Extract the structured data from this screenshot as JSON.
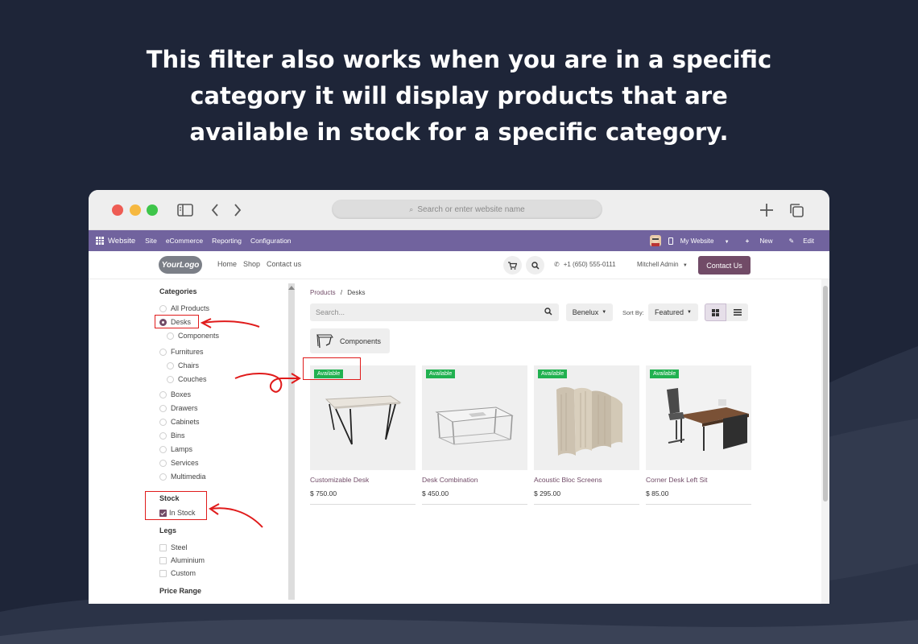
{
  "headline": {
    "line1": "This filter also works when you are in a specific",
    "line2": "category it will display products that are",
    "line3": "available in stock for a specific category."
  },
  "browser": {
    "url_placeholder": "Search or enter website name",
    "colors": {
      "close": "#ee5c54",
      "minimize": "#f6b840",
      "zoom": "#3ec54a"
    }
  },
  "odoo_nav": {
    "brand": "Website",
    "items": [
      "Site",
      "eCommerce",
      "Reporting",
      "Configuration"
    ],
    "my_website": "My Website",
    "new": "New",
    "edit": "Edit"
  },
  "site_header": {
    "logo": "YourLogo",
    "menu": [
      "Home",
      "Shop",
      "Contact us"
    ],
    "phone": "+1 (650) 555-0111",
    "user": "Mitchell Admin",
    "contact_button": "Contact Us"
  },
  "sidebar": {
    "categories_title": "Categories",
    "categories": [
      {
        "label": "All Products",
        "selected": false
      },
      {
        "label": "Desks",
        "selected": true
      },
      {
        "label": "Components",
        "selected": false
      },
      {
        "label": "Furnitures",
        "selected": false
      },
      {
        "label": "Chairs",
        "selected": false
      },
      {
        "label": "Couches",
        "selected": false
      },
      {
        "label": "Boxes",
        "selected": false
      },
      {
        "label": "Drawers",
        "selected": false
      },
      {
        "label": "Cabinets",
        "selected": false
      },
      {
        "label": "Bins",
        "selected": false
      },
      {
        "label": "Lamps",
        "selected": false
      },
      {
        "label": "Services",
        "selected": false
      },
      {
        "label": "Multimedia",
        "selected": false
      }
    ],
    "stock_title": "Stock",
    "stock_option": {
      "label": "In Stock",
      "checked": true
    },
    "legs_title": "Legs",
    "legs": [
      "Steel",
      "Aluminium",
      "Custom"
    ],
    "price_title": "Price Range"
  },
  "main": {
    "breadcrumb": {
      "parent": "Products",
      "separator": "/",
      "current": "Desks"
    },
    "search_placeholder": "Search...",
    "pricelist": "Benelux",
    "sort_label": "Sort By:",
    "sort_value": "Featured",
    "subcategory": "Components",
    "products": [
      {
        "name": "Customizable Desk",
        "price": "$ 750.00",
        "badge": "Available"
      },
      {
        "name": "Desk Combination",
        "price": "$ 450.00",
        "badge": "Available"
      },
      {
        "name": "Acoustic Bloc Screens",
        "price": "$ 295.00",
        "badge": "Available"
      },
      {
        "name": "Corner Desk Left Sit",
        "price": "$ 85.00",
        "badge": "Available"
      }
    ]
  },
  "accent_color": "#714b67",
  "nav_color": "#71639e",
  "badge_color": "#21b150",
  "highlight_color": "#e01b1b"
}
